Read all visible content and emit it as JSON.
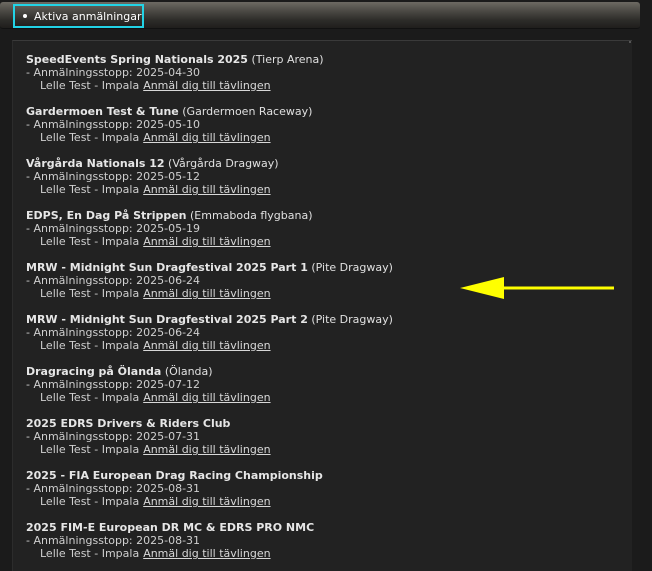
{
  "header": {
    "tab_label": "Aktiva anmälningar"
  },
  "events": [
    {
      "name": "SpeedEvents Spring Nationals 2025",
      "venue": "(Tierp Arena)",
      "deadline": "- Anmälningsstopp: 2025-04-30",
      "driver": "Lelle Test - Impala",
      "link": "Anmäl dig till tävlingen"
    },
    {
      "name": "Gardermoen Test & Tune",
      "venue": "(Gardermoen Raceway)",
      "deadline": "- Anmälningsstopp: 2025-05-10",
      "driver": "Lelle Test - Impala",
      "link": "Anmäl dig till tävlingen"
    },
    {
      "name": "Vårgårda Nationals 12",
      "venue": "(Vårgårda Dragway)",
      "deadline": "- Anmälningsstopp: 2025-05-12",
      "driver": "Lelle Test - Impala",
      "link": "Anmäl dig till tävlingen"
    },
    {
      "name": "EDPS, En Dag På Strippen",
      "venue": "(Emmaboda flygbana)",
      "deadline": "- Anmälningsstopp: 2025-05-19",
      "driver": "Lelle Test - Impala",
      "link": "Anmäl dig till tävlingen"
    },
    {
      "name": "MRW - Midnight Sun Dragfestival 2025 Part 1",
      "venue": "(Pite Dragway)",
      "deadline": "- Anmälningsstopp: 2025-06-24",
      "driver": "Lelle Test - Impala",
      "link": "Anmäl dig till tävlingen"
    },
    {
      "name": "MRW - Midnight Sun Dragfestival 2025 Part 2",
      "venue": "(Pite Dragway)",
      "deadline": "- Anmälningsstopp: 2025-06-24",
      "driver": "Lelle Test - Impala",
      "link": "Anmäl dig till tävlingen"
    },
    {
      "name": "Dragracing på Ölanda",
      "venue": "(Ölanda)",
      "deadline": "- Anmälningsstopp: 2025-07-12",
      "driver": "Lelle Test - Impala",
      "link": "Anmäl dig till tävlingen"
    },
    {
      "name": "2025 EDRS Drivers & Riders Club",
      "venue": "",
      "deadline": "- Anmälningsstopp: 2025-07-31",
      "driver": "Lelle Test - Impala",
      "link": "Anmäl dig till tävlingen"
    },
    {
      "name": "2025 - FIA European Drag Racing Championship",
      "venue": "",
      "deadline": "- Anmälningsstopp: 2025-08-31",
      "driver": "Lelle Test - Impala",
      "link": "Anmäl dig till tävlingen"
    },
    {
      "name": "2025 FIM-E European DR MC & EDRS PRO NMC",
      "venue": "",
      "deadline": "- Anmälningsstopp: 2025-08-31",
      "driver": "Lelle Test - Impala",
      "link": "Anmäl dig till tävlingen"
    }
  ],
  "colors": {
    "background": "#1b1b1b",
    "panel": "#222222",
    "tab_highlight": "#22d3e6",
    "annotation_arrow": "#ffff00"
  },
  "icons": {
    "annotation": "left-arrow-icon",
    "tab_bullet": "bullet-icon"
  }
}
